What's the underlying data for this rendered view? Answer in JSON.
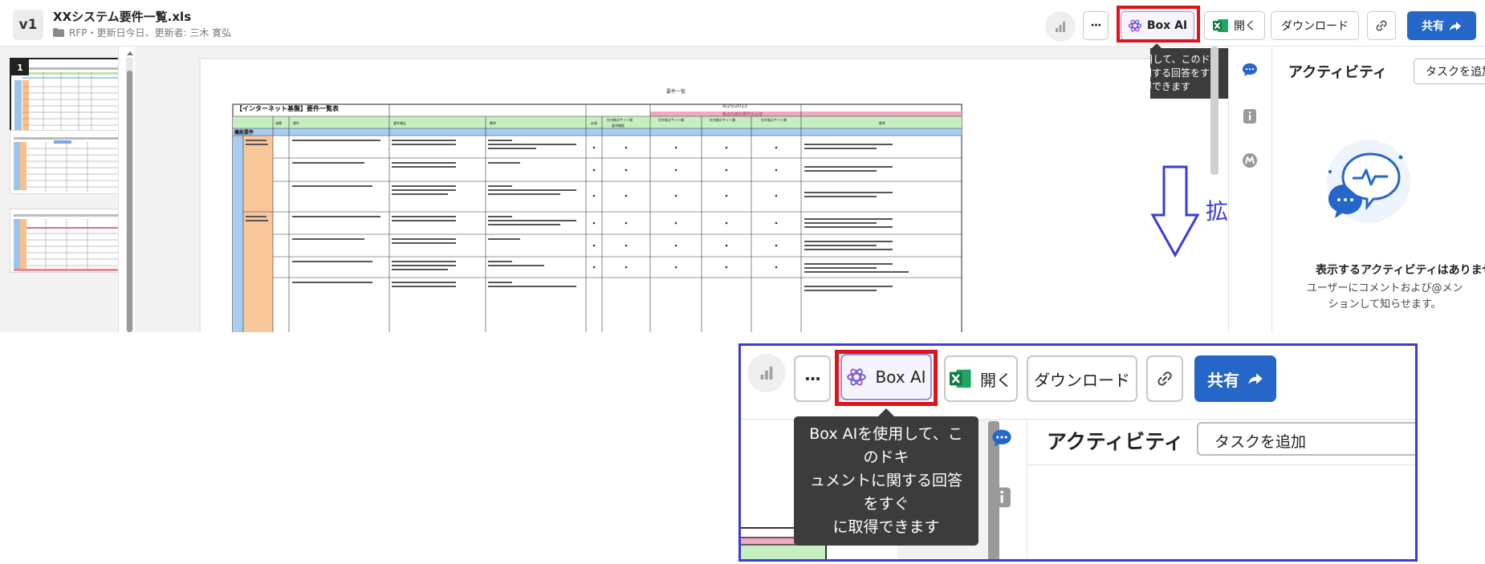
{
  "header": {
    "version": "v1",
    "file_title": "XXシステム要件一覧.xls",
    "meta": "RFP・更新日今日、更新者: 三木 寛弘"
  },
  "toolbar": {
    "more_label": "···",
    "box_ai_label": "Box AI",
    "open_label": "開く",
    "download_label": "ダウンロード",
    "share_label": "共有"
  },
  "tooltip": {
    "line1": "Box AIを使用して、このドキ",
    "line2": "ュメントに関する回答をすぐ",
    "line3": "に取得できます"
  },
  "thumbnails": [
    {
      "page": "1"
    }
  ],
  "annotation": {
    "zoom_label": "拡大"
  },
  "sidebar": {
    "title": "アクティビティ",
    "add_task_label": "タスクを追加",
    "empty_title": "表示するアクティビティはありません",
    "empty_desc_line1": "ユーザーにコメントおよび@メン",
    "empty_desc_line2": "ションして知らせます。"
  },
  "document": {
    "sheet_heading": "要件一覧",
    "date": "4/25/2013",
    "table_title": "【インターネット基盤】要件一覧表",
    "section_label": "機能要件",
    "columns": [
      "項番",
      "要件",
      "要件補足",
      "備考",
      "必須",
      "社内拠点サイト間",
      "社外拠点サイト間",
      "社内拠点サイト間",
      "社外拠点サイト間",
      "備考"
    ],
    "subheader": "要求機能",
    "group_header": "拠点内部の要件を記述"
  },
  "colors": {
    "accent_blue": "#2566c9",
    "highlight_red": "#e1131a",
    "annotation_blue": "#3b3bd6",
    "tooltip_bg": "#3c3c3c"
  }
}
